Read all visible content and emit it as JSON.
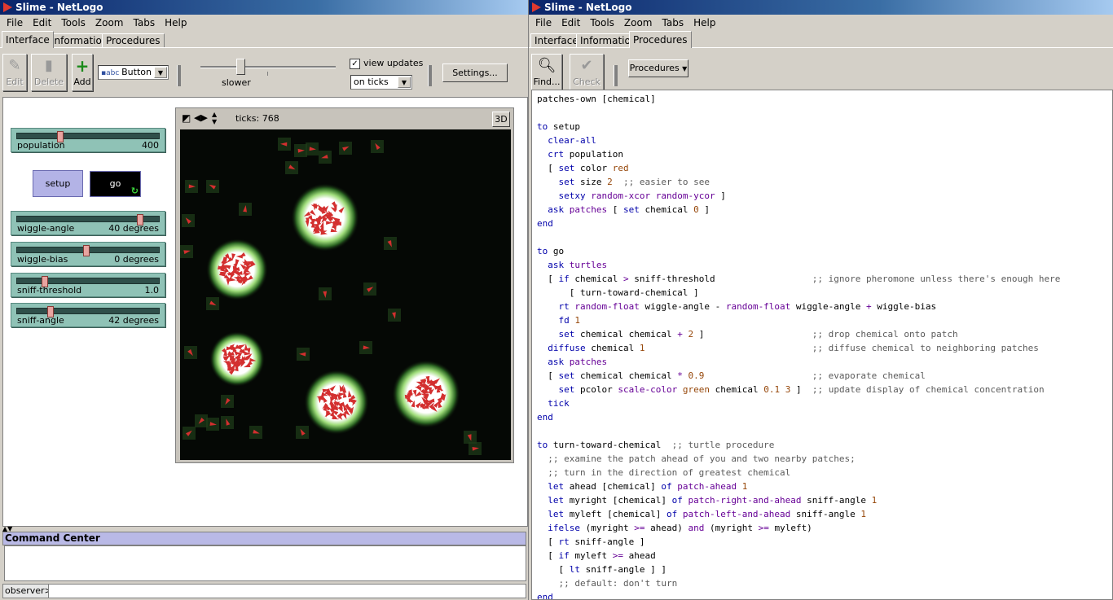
{
  "left": {
    "title": "Slime - NetLogo",
    "menu": [
      "File",
      "Edit",
      "Tools",
      "Zoom",
      "Tabs",
      "Help"
    ],
    "tabs": [
      "Interface",
      "Information",
      "Procedures"
    ],
    "toolbar": {
      "edit": "Edit",
      "delete": "Delete",
      "add": "Add",
      "widget_type": "Button",
      "speed_label": "slower",
      "view_updates": "view updates",
      "update_mode": "on ticks",
      "settings": "Settings..."
    },
    "sliders": [
      {
        "name": "population",
        "value": "400",
        "fraction": 0.3
      },
      {
        "name": "wiggle-angle",
        "value": "40 degrees",
        "fraction": 0.86
      },
      {
        "name": "wiggle-bias",
        "value": "0 degrees",
        "fraction": 0.48
      },
      {
        "name": "sniff-threshold",
        "value": "1.0",
        "fraction": 0.19
      },
      {
        "name": "sniff-angle",
        "value": "42 degrees",
        "fraction": 0.23
      }
    ],
    "buttons": {
      "setup": "setup",
      "go": "go"
    },
    "view": {
      "ticks": "ticks: 768",
      "three_d": "3D"
    },
    "command_center": {
      "title": "Command Center",
      "prompt": "observer>"
    }
  },
  "right": {
    "title": "Slime - NetLogo",
    "menu": [
      "File",
      "Edit",
      "Tools",
      "Zoom",
      "Tabs",
      "Help"
    ],
    "tabs": [
      "Interface",
      "Information",
      "Procedures"
    ],
    "toolbar": {
      "find": "Find...",
      "check": "Check",
      "procedures": "Procedures"
    },
    "code": [
      "patches-own [chemical]",
      "",
      "to setup",
      "  clear-all",
      "  crt population",
      "  [ set color red",
      "    set size 2  ;; easier to see",
      "    setxy random-xcor random-ycor ]",
      "  ask patches [ set chemical 0 ]",
      "end",
      "",
      "to go",
      "  ask turtles",
      "  [ if chemical > sniff-threshold                  ;; ignore pheromone unless there's enough here",
      "      [ turn-toward-chemical ]",
      "    rt random-float wiggle-angle - random-float wiggle-angle + wiggle-bias",
      "    fd 1",
      "    set chemical chemical + 2 ]                    ;; drop chemical onto patch",
      "  diffuse chemical 1                               ;; diffuse chemical to neighboring patches",
      "  ask patches",
      "  [ set chemical chemical * 0.9                    ;; evaporate chemical",
      "    set pcolor scale-color green chemical 0.1 3 ]  ;; update display of chemical concentration",
      "  tick",
      "end",
      "",
      "to turn-toward-chemical  ;; turtle procedure",
      "  ;; examine the patch ahead of you and two nearby patches;",
      "  ;; turn in the direction of greatest chemical",
      "  let ahead [chemical] of patch-ahead 1",
      "  let myright [chemical] of patch-right-and-ahead sniff-angle 1",
      "  let myleft [chemical] of patch-left-and-ahead sniff-angle 1",
      "  ifelse (myright >= ahead) and (myright >= myleft)",
      "  [ rt sniff-angle ]",
      "  [ if myleft >= ahead",
      "    [ lt sniff-angle ] ]",
      "    ;; default: don't turn",
      "end"
    ]
  },
  "colors": {
    "turtle": "#d32f2f",
    "chemical": "#6cc34a",
    "background": "#050805"
  }
}
